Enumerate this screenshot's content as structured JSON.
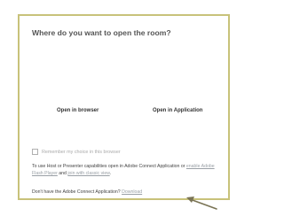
{
  "dialog": {
    "title": "Where do you want to open the room?",
    "options": {
      "browser": "Open in browser",
      "application": "Open in Application"
    },
    "remember_label": "Remember my choice in this browser",
    "info": {
      "text1": "To use Host or Presenter capabilities open in Adobe Connect Application or ",
      "flash_link": "enable Adobe Flash Player",
      "text2": " and ",
      "classic_link": "join with classic view",
      "text3": "."
    },
    "download": {
      "prompt": "Don't have the Adobe Connect Application? ",
      "link": "Download"
    }
  },
  "colors": {
    "frame_border": "#c8c27a",
    "arrow": "#7a7455",
    "link": "#9aa0a6"
  },
  "icons": {
    "annotation_arrow": "arrow-icon"
  }
}
